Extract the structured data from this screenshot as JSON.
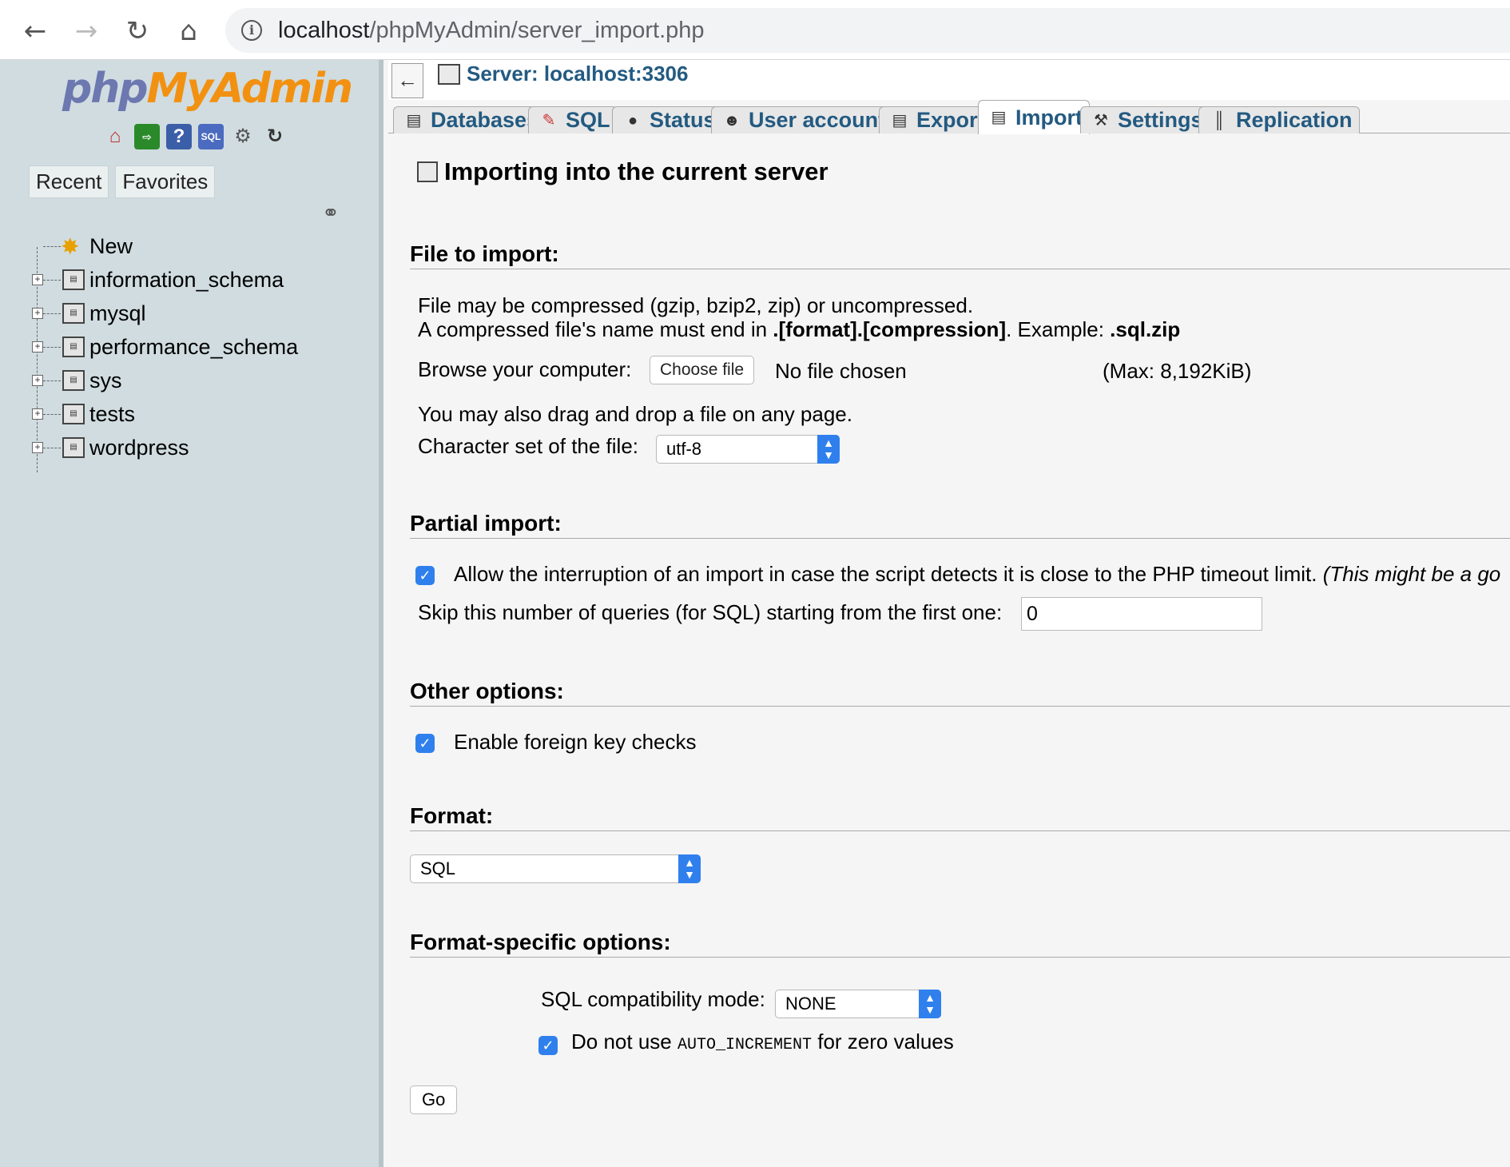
{
  "browser": {
    "url_host": "localhost",
    "url_path": "/phpMyAdmin/server_import.php"
  },
  "sidebar": {
    "logo_php": "php",
    "logo_ma": "MyAdmin",
    "tabs": [
      "Recent",
      "Favorites"
    ],
    "tree": [
      "New",
      "information_schema",
      "mysql",
      "performance_schema",
      "sys",
      "tests",
      "wordpress"
    ]
  },
  "header": {
    "server": "Server: localhost:3306"
  },
  "tabs": [
    "Databases",
    "SQL",
    "Status",
    "User accounts",
    "Export",
    "Import",
    "Settings",
    "Replication"
  ],
  "page": {
    "title": "Importing into the current server"
  },
  "file_to_import": {
    "heading": "File to import:",
    "line1": "File may be compressed (gzip, bzip2, zip) or uncompressed.",
    "line2_pre": "A compressed file's name must end in ",
    "line2_bold": ".[format].[compression]",
    "line2_mid": ". Example: ",
    "line2_example": ".sql.zip",
    "browse_label": "Browse your computer:",
    "choose_file": "Choose file",
    "no_file": "No file chosen",
    "max_size": "(Max: 8,192KiB)",
    "drag_drop": "You may also drag and drop a file on any page.",
    "charset_label": "Character set of the file:",
    "charset_value": "utf-8"
  },
  "partial_import": {
    "heading": "Partial import:",
    "allow_interrupt": "Allow the interruption of an import in case the script detects it is close to the PHP timeout limit.",
    "allow_interrupt_note": "(This might be a go",
    "skip_label": "Skip this number of queries (for SQL) starting from the first one:",
    "skip_value": "0"
  },
  "other_options": {
    "heading": "Other options:",
    "foreign_keys": "Enable foreign key checks"
  },
  "format": {
    "heading": "Format:",
    "value": "SQL"
  },
  "format_specific": {
    "heading": "Format-specific options:",
    "compat_label": "SQL compatibility mode:",
    "compat_value": "NONE",
    "auto_inc_pre": "Do not use ",
    "auto_inc_code": "AUTO_INCREMENT",
    "auto_inc_post": " for zero values"
  },
  "go_button": "Go"
}
